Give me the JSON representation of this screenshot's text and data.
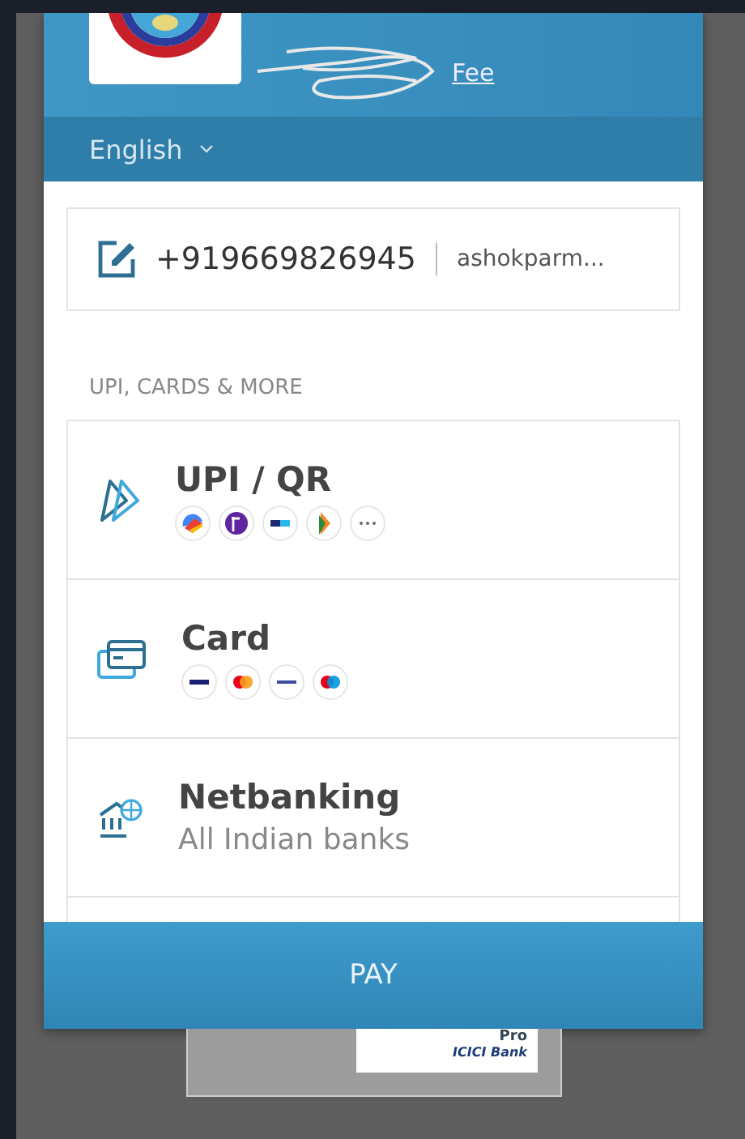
{
  "header": {
    "title": "Fee",
    "language": "English"
  },
  "contact": {
    "phone": "+919669826945",
    "email": "ashokparm..."
  },
  "section_label": "UPI, CARDS & MORE",
  "methods": [
    {
      "title": "UPI / QR"
    },
    {
      "title": "Card"
    },
    {
      "title": "Netbanking",
      "subtitle": "All Indian banks"
    }
  ],
  "pay_button": "PAY",
  "footer": {
    "badge_title": "Pro",
    "badge_bank": "ICICI Bank"
  }
}
